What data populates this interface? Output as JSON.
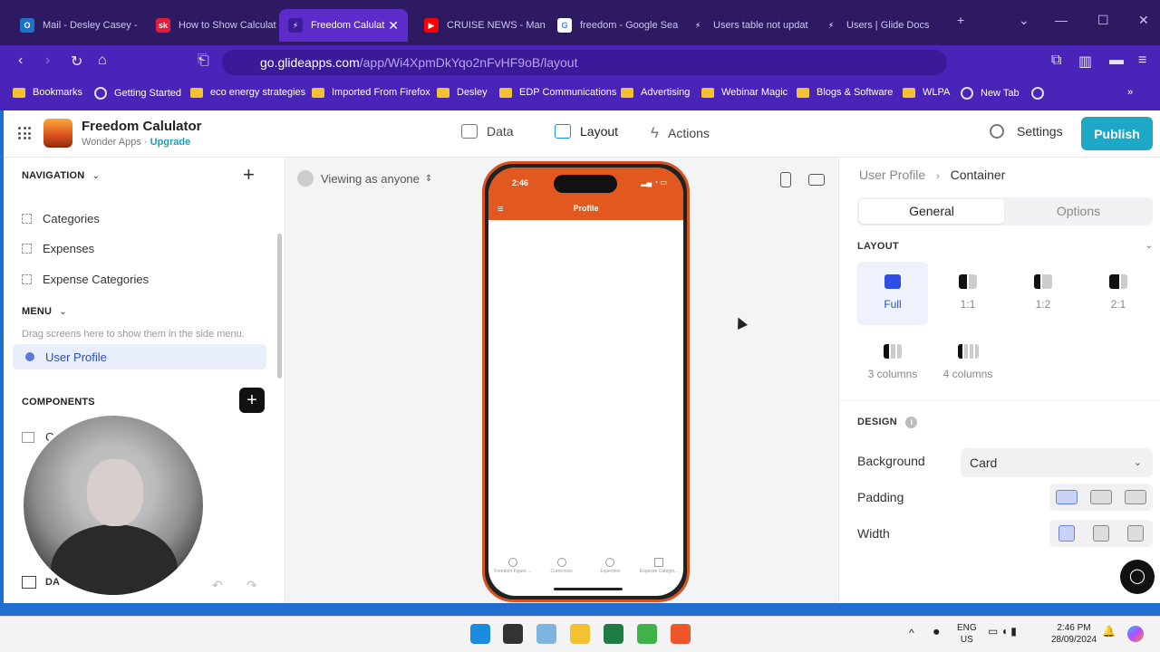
{
  "browser": {
    "tabs": [
      {
        "title": "Mail - Desley Casey - ",
        "icon": "outlook-icon",
        "color": "#1a73c8"
      },
      {
        "title": "How to Show Calculat",
        "icon": "sk-icon",
        "color": "#e41b3b"
      },
      {
        "title": "Freedom Calulat",
        "icon": "glide-icon",
        "color": "#5b2cc9"
      },
      {
        "title": "CRUISE NEWS - Man",
        "icon": "youtube-icon",
        "color": "#ff0000"
      },
      {
        "title": "freedom - Google Sea",
        "icon": "google-icon",
        "color": "#ffffff"
      },
      {
        "title": "Users table not updat",
        "icon": "glide-icon",
        "color": "#2d1a63"
      },
      {
        "title": "Users | Glide Docs",
        "icon": "glide-icon",
        "color": "#2d1a63"
      }
    ],
    "url_host": "go.glideapps.com",
    "url_path": "/app/Wi4XpmDkYqo2nFvHF9oB/layout",
    "bookmarks": [
      "Bookmarks",
      "Getting Started",
      "eco energy strategies",
      "Imported From Firefox",
      "Desley",
      "EDP Communications",
      "Advertising",
      "Webinar Magic",
      "Blogs & Software",
      "WLPA",
      "New Tab"
    ]
  },
  "app": {
    "title": "Freedom Calulator",
    "workspace": "Wonder Apps",
    "separator": "·",
    "upgrade": "Upgrade",
    "nav": {
      "data": "Data",
      "layout": "Layout",
      "actions": "Actions"
    },
    "settings": "Settings",
    "publish": "Publish"
  },
  "sidebar": {
    "navigation_label": "NAVIGATION",
    "nav_items": [
      "Categories",
      "Expenses",
      "Expense Categories"
    ],
    "menu_label": "MENU",
    "drag_hint": "Drag screens here to show them in the side menu.",
    "menu_item": "User Profile",
    "components_label": "COMPONENTS",
    "data_label": "DA"
  },
  "canvas": {
    "viewing_as": "Viewing as anyone",
    "phone_time": "2:46",
    "screen_title": "Profile",
    "tabs": [
      "Freedom Figure ...",
      "Currencies",
      "Expenses",
      "Expense Categor..."
    ]
  },
  "inspector": {
    "breadcrumb_parent": "User Profile",
    "breadcrumb_sep": "›",
    "breadcrumb_current": "Container",
    "tab_general": "General",
    "tab_options": "Options",
    "layout_label": "LAYOUT",
    "layout_options": [
      "Full",
      "1:1",
      "1:2",
      "2:1",
      "3 columns",
      "4 columns"
    ],
    "design_label": "DESIGN",
    "background_label": "Background",
    "background_value": "Card",
    "padding_label": "Padding",
    "width_label": "Width"
  },
  "taskbar": {
    "lang1": "ENG",
    "lang2": "US",
    "time": "2:46 PM",
    "date": "28/09/2024"
  }
}
